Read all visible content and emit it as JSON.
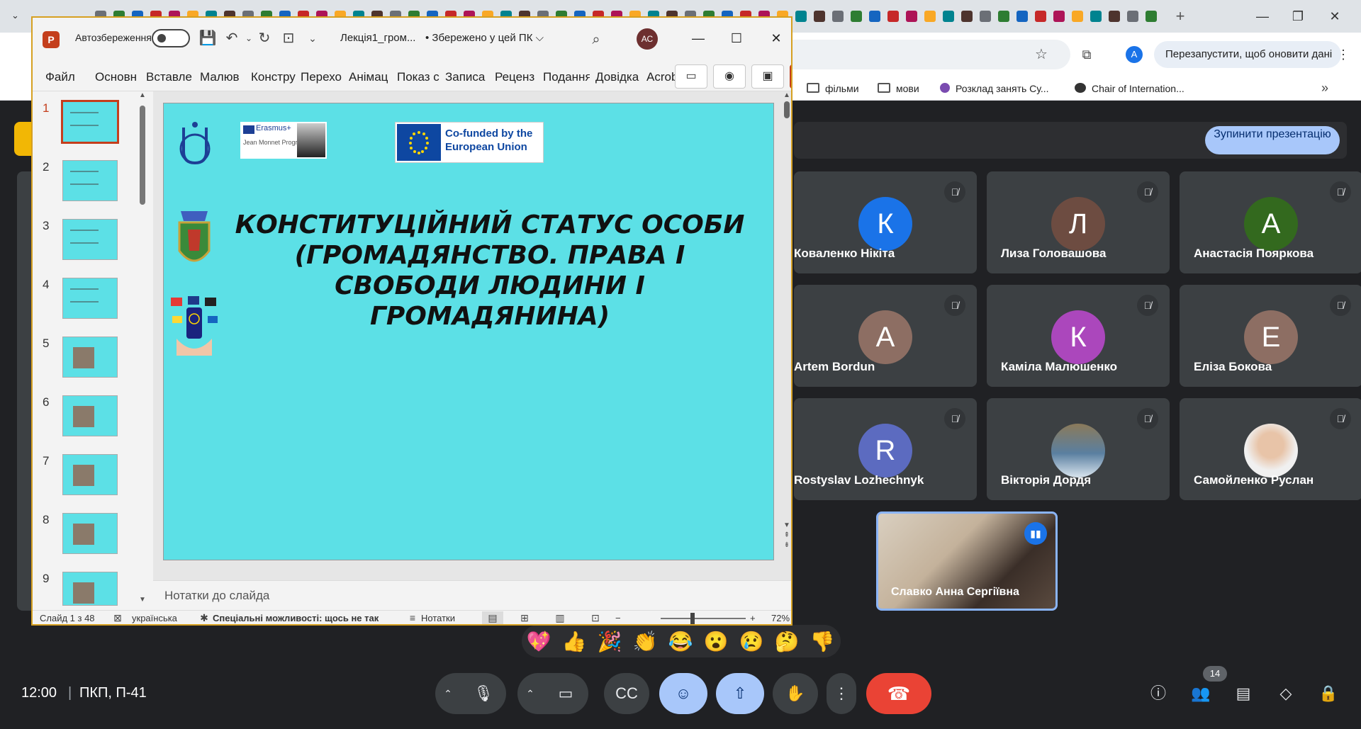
{
  "browser": {
    "relaunch_label": "Перезапустити, щоб оновити дані",
    "profile_initial": "A",
    "bookmarks": [
      {
        "label": "фільми",
        "type": "folder"
      },
      {
        "label": "мови",
        "type": "folder"
      },
      {
        "label": "Розклад занять Су...",
        "type": "page"
      },
      {
        "label": "Chair of Internation...",
        "type": "page"
      }
    ]
  },
  "meet": {
    "stop_presenting_label": "Зупинити презентацію",
    "clock": "12:00",
    "separator": "|",
    "room": "ПКП, П-41",
    "people_count": "14",
    "participants": [
      {
        "name": "Коваленко Нікіта",
        "initial": "К",
        "color": "#1a73e8"
      },
      {
        "name": "Лиза Головашова",
        "initial": "Л",
        "color": "#6d4c41"
      },
      {
        "name": "Анастасія Пояркова",
        "initial": "А",
        "color": "#33691e"
      },
      {
        "name": "Artem Bordun",
        "initial": "A",
        "color": "#8d6e63"
      },
      {
        "name": "Каміла Малюшенко",
        "initial": "К",
        "color": "#ab47bc"
      },
      {
        "name": "Еліза Бокова",
        "initial": "Е",
        "color": "#8d6e63"
      },
      {
        "name": "Rostyslav Lozhechnyk",
        "initial": "R",
        "color": "#5c6bc0"
      },
      {
        "name": "Вікторія Дордя",
        "initial": "",
        "color": "#3a6a8a"
      },
      {
        "name": "Самойленко Руслан",
        "initial": "",
        "color": "#d7d7d7"
      }
    ],
    "self_name": "Славко Анна Сергіївна",
    "reactions": [
      "💖",
      "👍",
      "🎉",
      "👏",
      "😂",
      "😮",
      "😢",
      "🤔",
      "👎"
    ]
  },
  "ppt": {
    "autosave_label": "Автозбереження",
    "doc_name": "Лекція1_гром...",
    "doc_saved": "• Збережено у цей ПК ⌵",
    "user_initials": "АС",
    "tabs": [
      "Файл",
      "Основн",
      "Вставле",
      "Малюв",
      "Констру",
      "Перехо",
      "Анімац",
      "Показ с",
      "Записа",
      "Реценз",
      "Подання",
      "Довідка",
      "Acrobat"
    ],
    "slide_numbers": [
      "1",
      "2",
      "3",
      "4",
      "5",
      "6",
      "7",
      "8",
      "9"
    ],
    "slide": {
      "title": "КОНСТИТУЦІЙНИЙ СТАТУС ОСОБИ (ГРОМАДЯНСТВО. ПРАВА І СВОБОДИ ЛЮДИНИ І ГРОМАДЯНИНА)",
      "erasmus_text": "Erasmus+",
      "erasmus_sub": "Jean Monnet Programme",
      "eu_text": "Co-funded by the European Union"
    },
    "notes_placeholder": "Нотатки до слайда",
    "status": {
      "slide_counter": "Слайд 1 з 48",
      "language": "українська",
      "accessibility": "Спеціальні можливості: щось не так",
      "notes_label": "Нотатки",
      "zoom": "72%",
      "zoom_minus": "−",
      "zoom_plus": "+"
    }
  }
}
